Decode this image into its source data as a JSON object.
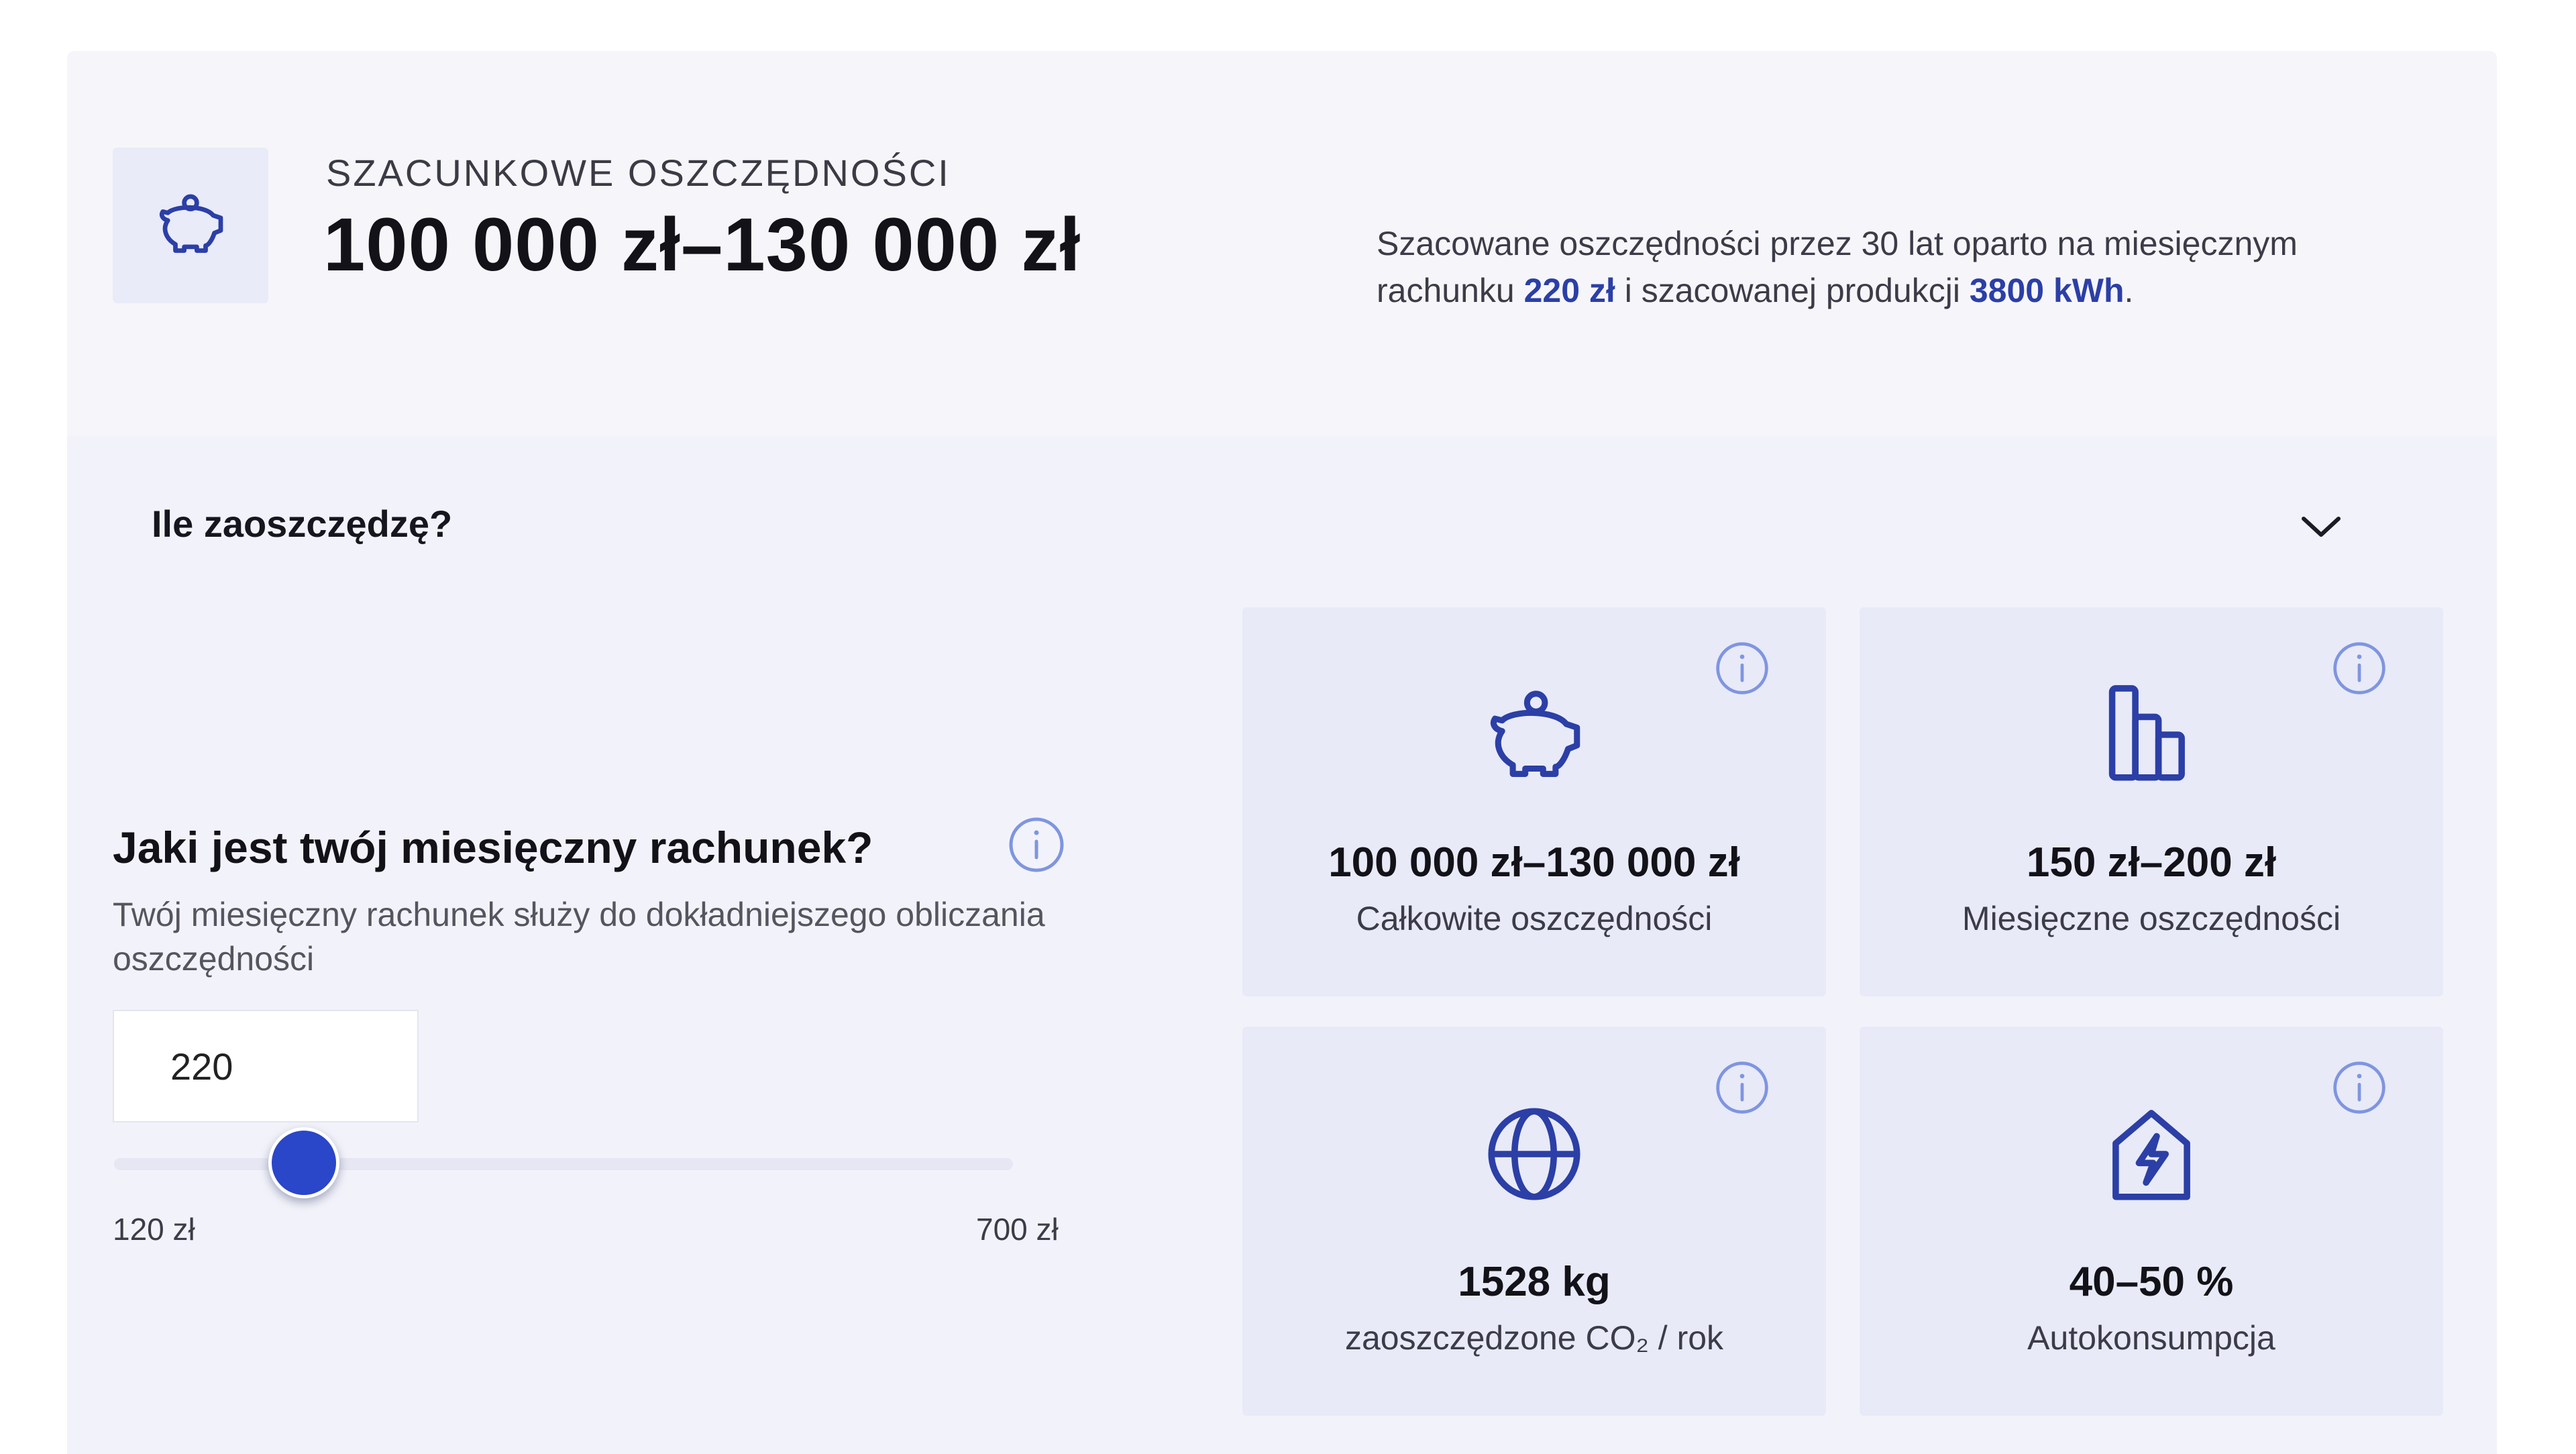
{
  "header": {
    "icon": "piggy-bank-icon",
    "label": "SZACUNKOWE OSZCZĘDNOŚCI",
    "value": "100 000 zł–130 000 zł",
    "description_part1": "Szacowane oszczędności przez 30 lat oparto na miesięcznym rachunku ",
    "description_bill": "220 zł",
    "description_part2": " i szacowanej produkcji ",
    "description_production": "3800 kWh",
    "description_end": "."
  },
  "accordion": {
    "title": "Ile zaoszczędzę?",
    "icon": "chevron-down-icon"
  },
  "bill": {
    "question": "Jaki jest twój miesięczny rachunek?",
    "description": "Twój miesięczny rachunek służy do dokładniejszego obliczania oszczędności",
    "input_value": "220",
    "slider_min_label": "120 zł",
    "slider_max_label": "700 zł",
    "slider_min": 120,
    "slider_max": 700,
    "slider_value": 220
  },
  "cards": [
    {
      "icon": "piggy-bank-icon",
      "value": "100 000 zł–130 000 zł",
      "label": "Całkowite oszczędności"
    },
    {
      "icon": "bar-chart-icon",
      "value": "150 zł–200 zł",
      "label": "Miesięczne oszczędności"
    },
    {
      "icon": "globe-icon",
      "value": "1528 kg",
      "label": "zaoszczędzone CO₂ / rok"
    },
    {
      "icon": "house-bolt-icon",
      "value": "40–50 %",
      "label": "Autokonsumpcja"
    }
  ],
  "colors": {
    "accent": "#2a46c9",
    "icon_stroke": "#2b3fa6",
    "info_icon": "#7f95e0",
    "card_bg": "#e8eaf8",
    "panel_bg": "#f6f6fa"
  }
}
